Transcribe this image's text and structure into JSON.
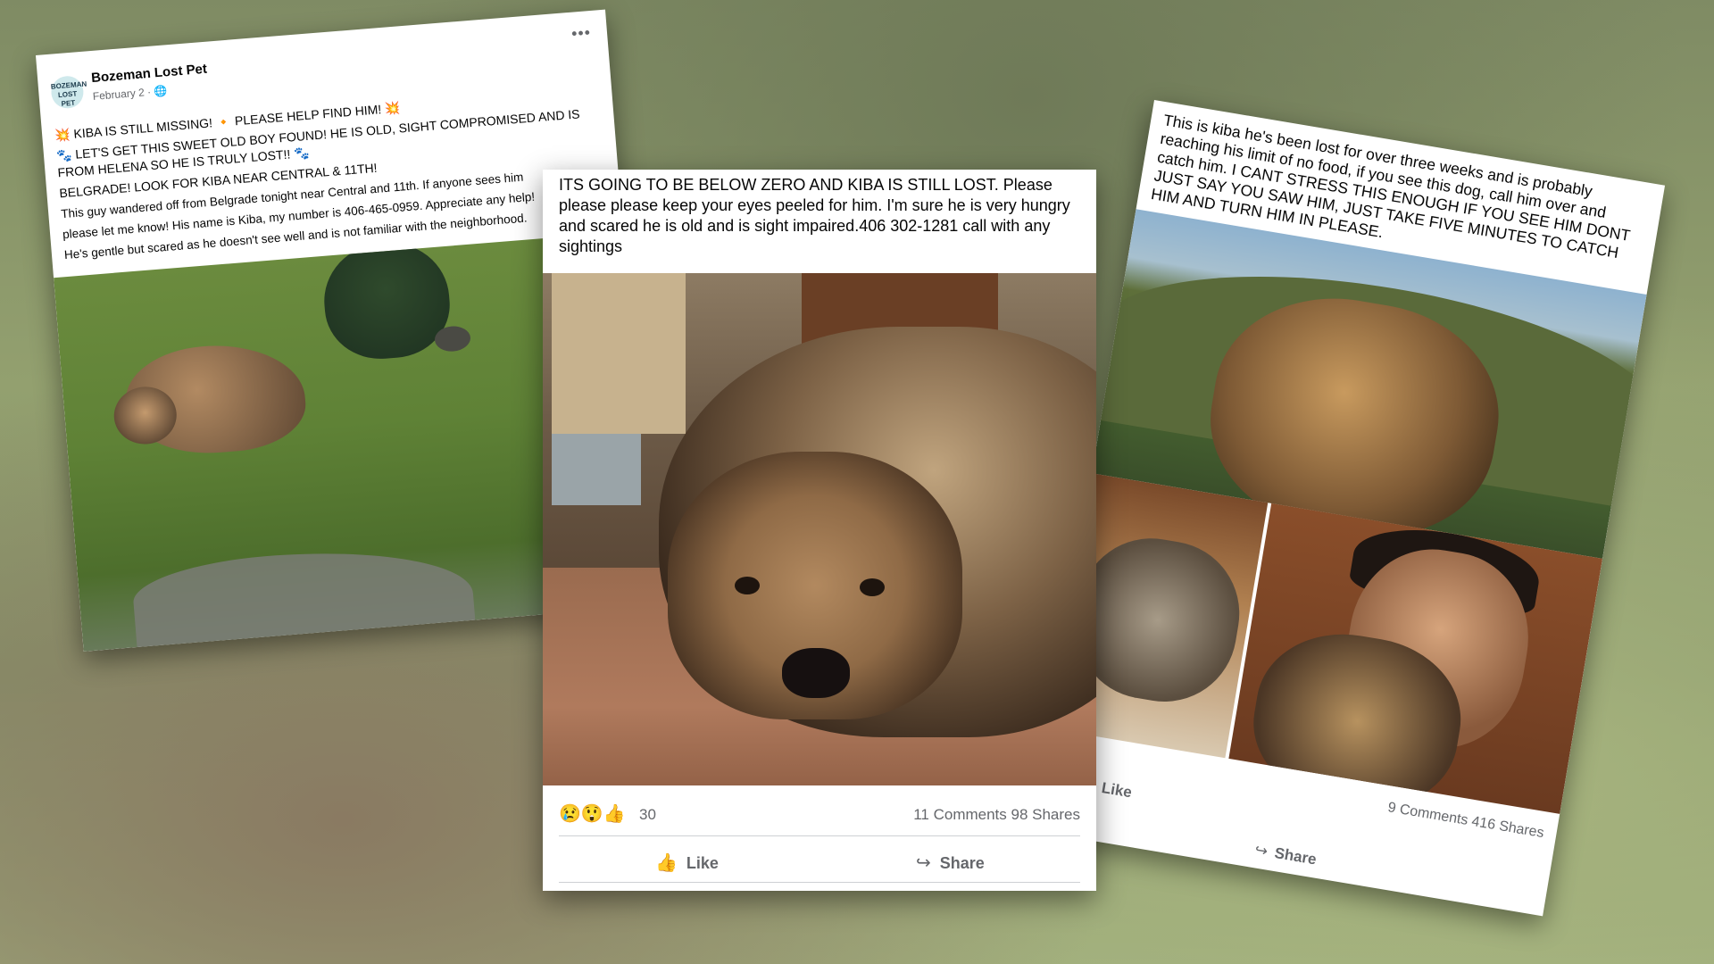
{
  "left_post": {
    "page_name": "Bozeman Lost Pet",
    "avatar_text": "BOZEMAN LOST PET",
    "date": "February 2 · 🌐",
    "more": "•••",
    "lines": [
      "💥 KIBA IS STILL MISSING! 🔸 PLEASE HELP FIND HIM! 💥",
      "🐾 LET'S GET THIS SWEET OLD BOY FOUND! HE IS OLD, SIGHT COMPROMISED AND IS FROM HELENA SO HE IS TRULY LOST!! 🐾",
      "BELGRADE!  LOOK FOR KIBA NEAR CENTRAL & 11TH!"
    ],
    "small_lines": [
      "This guy wandered off from Belgrade tonight near Central and 11th. If anyone sees him",
      "please let me know!  His name is Kiba, my number is 406-465-0959. Appreciate any help!",
      "He's gentle but scared as he doesn't see well and is not familiar with the neighborhood."
    ]
  },
  "center_post": {
    "text": "ITS GOING TO BE BELOW ZERO AND KIBA IS STILL LOST. Please please please keep your eyes peeled for him. I'm sure he is very hungry and scared he is old and is sight impaired.406 302-1281 call with any sightings",
    "reactions_icons": "😢😲👍",
    "reactions_count": "30",
    "comments_shares": "11 Comments  98 Shares",
    "like_label": "Like",
    "share_label": "Share"
  },
  "right_post": {
    "text": "This is kiba he's been lost for over three weeks and is probably reaching his limit of no food, if you see this dog, call him over and catch him. I CANT STRESS THIS ENOUGH IF YOU SEE HIM DONT JUST SAY YOU SAW HIM, JUST TAKE FIVE MINUTES TO CATCH HIM AND TURN HIM IN PLEASE.",
    "comments_shares": "9 Comments  416 Shares",
    "like_label": "Like",
    "share_label": "Share"
  }
}
